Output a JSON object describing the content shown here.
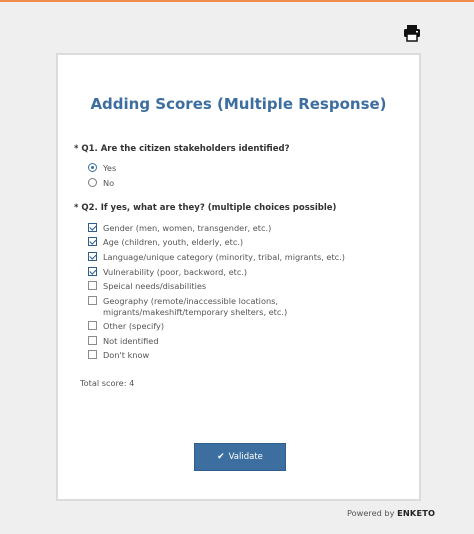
{
  "form": {
    "title": "Adding Scores (Multiple Response)",
    "q1": {
      "label": "* Q1. Are the citizen stakeholders identified?",
      "options": [
        {
          "label": "Yes",
          "checked": true
        },
        {
          "label": "No",
          "checked": false
        }
      ]
    },
    "q2": {
      "label": "* Q2. If yes, what are they? (multiple choices possible)",
      "options": [
        {
          "label": "Gender (men, women, transgender, etc.)",
          "checked": true
        },
        {
          "label": "Age (children, youth, elderly, etc.)",
          "checked": true
        },
        {
          "label": "Language/unique category (minority, tribal, migrants, etc.)",
          "checked": true
        },
        {
          "label": "Vulnerability (poor, backword, etc.)",
          "checked": true
        },
        {
          "label": "Speical needs/disabilities",
          "checked": false
        },
        {
          "label": "Geography (remote/inaccessible locations, migrants/makeshift/temporary shelters, etc.)",
          "checked": false
        },
        {
          "label": "Other (specify)",
          "checked": false
        },
        {
          "label": "Not identified",
          "checked": false
        },
        {
          "label": "Don't know",
          "checked": false
        }
      ]
    },
    "total_score": "Total score: 4",
    "validate_label": "Validate"
  },
  "footer": {
    "powered_by": "Powered by",
    "brand": "ENKETO"
  },
  "icons": {
    "print": "printer-icon",
    "validate": "check-icon"
  },
  "colors": {
    "accent": "#3c6f9f",
    "top_bar": "#ef8b4b"
  }
}
